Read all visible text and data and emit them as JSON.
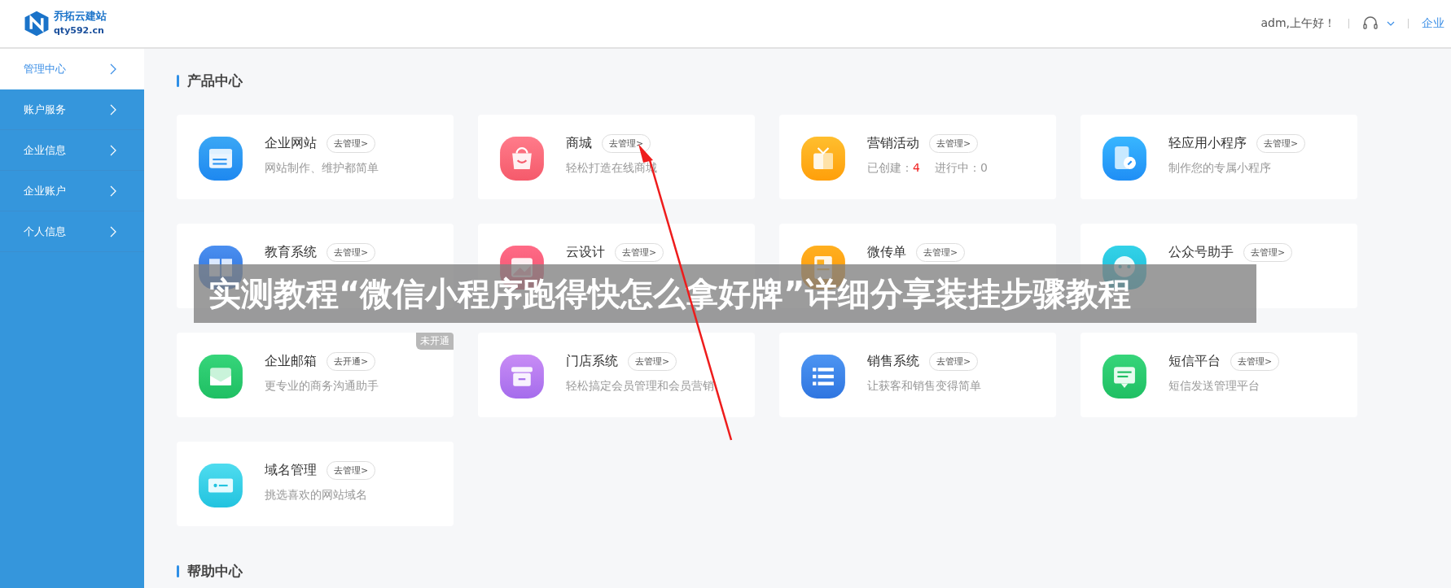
{
  "header": {
    "logo_name": "乔拓云建站",
    "logo_domain": "qty592.cn",
    "greeting": "adm,上午好！",
    "overview_link": "企业"
  },
  "sidebar": {
    "items": [
      {
        "label": "管理中心",
        "selected": true
      },
      {
        "label": "账户服务",
        "selected": false
      },
      {
        "label": "企业信息",
        "selected": false
      },
      {
        "label": "企业账户",
        "selected": false
      },
      {
        "label": "个人信息",
        "selected": false
      }
    ]
  },
  "products": {
    "title": "产品中心",
    "cards": [
      {
        "kind": "website",
        "name": "企业网站",
        "action": "去管理>",
        "description": "网站制作、维护都简单"
      },
      {
        "kind": "shop",
        "name": "商城",
        "action": "去管理>",
        "description": "轻松打造在线商城"
      },
      {
        "kind": "gift",
        "name": "营销活动",
        "action": "去管理>",
        "stats": [
          {
            "label": "已创建：",
            "value": "4",
            "highlight": true
          },
          {
            "label": "进行中：",
            "value": "0",
            "highlight": false
          }
        ]
      },
      {
        "kind": "miniapp",
        "name": "轻应用小程序",
        "action": "去管理>",
        "description": "制作您的专属小程序"
      },
      {
        "kind": "book",
        "name": "教育系统",
        "action": "去管理>"
      },
      {
        "kind": "image",
        "name": "云设计",
        "action": "去管理>"
      },
      {
        "kind": "flyer",
        "name": "微传单",
        "action": "去管理>"
      },
      {
        "kind": "chat",
        "name": "公众号助手",
        "action": "去管理>"
      },
      {
        "kind": "mail",
        "name": "企业邮箱",
        "action": "去开通>",
        "description": "更专业的商务沟通助手",
        "badge": "未开通"
      },
      {
        "kind": "store",
        "name": "门店系统",
        "action": "去管理>",
        "description": "轻松搞定会员管理和会员营销"
      },
      {
        "kind": "list",
        "name": "销售系统",
        "action": "去管理>",
        "description": "让获客和销售变得简单"
      },
      {
        "kind": "sms",
        "name": "短信平台",
        "action": "去管理>",
        "description": "短信发送管理平台"
      },
      {
        "kind": "domain",
        "name": "域名管理",
        "action": "去管理>",
        "description": "挑选喜欢的网站域名"
      }
    ]
  },
  "help": {
    "title": "帮助中心"
  },
  "banner": {
    "text": "实测教程“微信小程序跑得快怎么拿好牌”详细分享装挂步骤教程"
  }
}
